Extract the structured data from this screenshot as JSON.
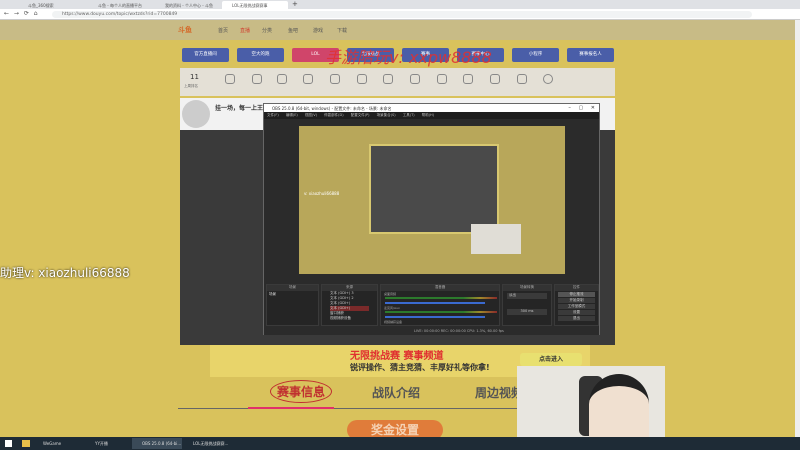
{
  "browser": {
    "tabs": [
      {
        "label": "斗鱼_360搜索"
      },
      {
        "label": "斗鱼 - 每个人的直播平台"
      },
      {
        "label": "我的资料 - 个人中心 - 斗鱼"
      },
      {
        "label": "LOL无限挑战赛赛事"
      }
    ],
    "url": "https://www.douyu.com/topic/wxtzds?rid=7700849"
  },
  "site": {
    "logo": "斗鱼",
    "nav": [
      "首页",
      "直播",
      "分类",
      "鱼吧",
      "游戏",
      "下载"
    ]
  },
  "buttons": [
    "官方直播间",
    "空大的跑",
    "LOL",
    "无限挑战",
    "赛事",
    "赛事中心",
    "小程序",
    "赛事报名人"
  ],
  "watermark": "手游陪玩v: xxpw8888",
  "stats": {
    "count": "11",
    "label": "上周排名"
  },
  "streamer": {
    "title": "挂一场，每一上王者"
  },
  "overlay_left": "助理v: xiaozhuli66888",
  "obs": {
    "title": "OBS 25.0.8 (64-bit, windows) - 配置文件: 未命名 - 场景: 未命名",
    "menu": "文件(F) 编辑(E) 视图(V) 停靠部件(D) 配置文件(P) 场景集合(S) 工具(T) 帮助(H)",
    "preview_text": "v: xiaozhuli66888",
    "docks": [
      "场景",
      "来源",
      "混音器",
      "场景转换",
      "控件"
    ],
    "scene": "场景",
    "sources": [
      "文本 (GDI+) 3",
      "文本 (GDI+) 2",
      "文本 (GDI+)",
      "文本 (GDI+)",
      "窗口捕获",
      "视频捕获设备"
    ],
    "mixer": [
      "桌面音频",
      "麦克风/Aux",
      "视频捕获设备"
    ],
    "transition": "淡出",
    "duration": "300 ms",
    "controls": [
      "停止推流",
      "开始录制",
      "工作室模式",
      "设置",
      "退出"
    ],
    "status": "LIVE: 00:00:00  REC: 00:00:00  CPU: 1.3%, 60.00 fps"
  },
  "banner": {
    "title": "无限挑战赛 赛事频道",
    "subtitle": "锐评操作、猜主竞猜、丰厚好礼等你拿!",
    "enter": "点击进入"
  },
  "page_tabs": [
    "赛事信息",
    "战队介绍",
    "周边视频"
  ],
  "prize": "奖金设置",
  "taskbar": [
    "WeGame",
    "YY开播",
    "OBS 25.0.8 (64-bi...",
    "LOL无限挑战赛赛..."
  ],
  "colors": {
    "page_bg": "#d9c25c",
    "button_blue": "#4a5ea8",
    "button_pink": "#d0456a",
    "accent_red": "#e23030"
  }
}
